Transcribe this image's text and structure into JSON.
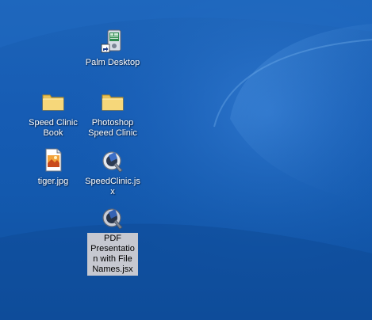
{
  "desktop": {
    "background_color": "#1a5fb4",
    "icons": [
      {
        "label": "Palm Desktop",
        "icon": "palm-desktop-shortcut-icon",
        "selected": false
      },
      {
        "label": "Speed Clinic Book",
        "icon": "folder-icon",
        "selected": false
      },
      {
        "label": "Photoshop Speed Clinic",
        "icon": "folder-icon",
        "selected": false
      },
      {
        "label": "tiger.jpg",
        "icon": "image-file-icon",
        "selected": false
      },
      {
        "label": "SpeedClinic.jsx",
        "icon": "script-file-icon",
        "selected": false
      },
      {
        "label": "PDF Presentation with File Names.jsx",
        "icon": "script-file-icon",
        "selected": true
      }
    ]
  }
}
